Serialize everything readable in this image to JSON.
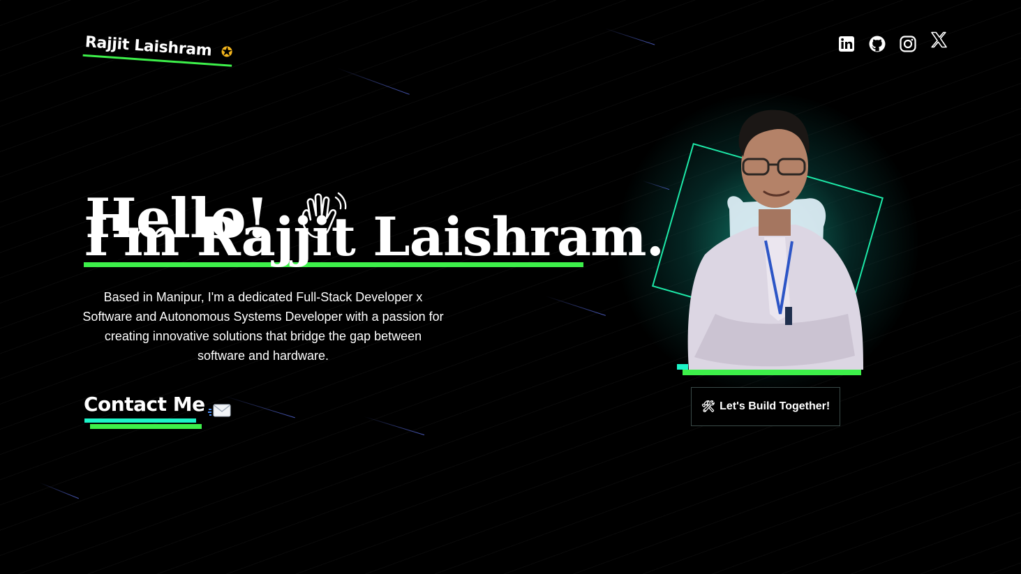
{
  "header": {
    "logo_text": "Rajjit Laishram",
    "logo_icon": "shooting-star-icon",
    "social_links": [
      {
        "icon": "linkedin-icon"
      },
      {
        "icon": "github-icon"
      },
      {
        "icon": "instagram-icon"
      },
      {
        "icon": "x-twitter-icon"
      }
    ]
  },
  "hero": {
    "greeting": "Hello!",
    "greeting_icon": "waving-hand-icon",
    "name_line": "I'm Rajjit Laishram.",
    "bio": "Based in Manipur, I'm a dedicated Full-Stack Developer x Software and Autonomous Systems Developer with a passion for creating innovative solutions that bridge the gap between software and hardware.",
    "contact_label": "Contact Me",
    "contact_icon": "envelope-icon"
  },
  "profile": {
    "cta_icon": "🛠",
    "cta_label": "Let's Build Together!"
  },
  "colors": {
    "background": "#000000",
    "accent_green": "#3df04a",
    "accent_teal": "#1cf5c8",
    "glow": "#169682"
  }
}
